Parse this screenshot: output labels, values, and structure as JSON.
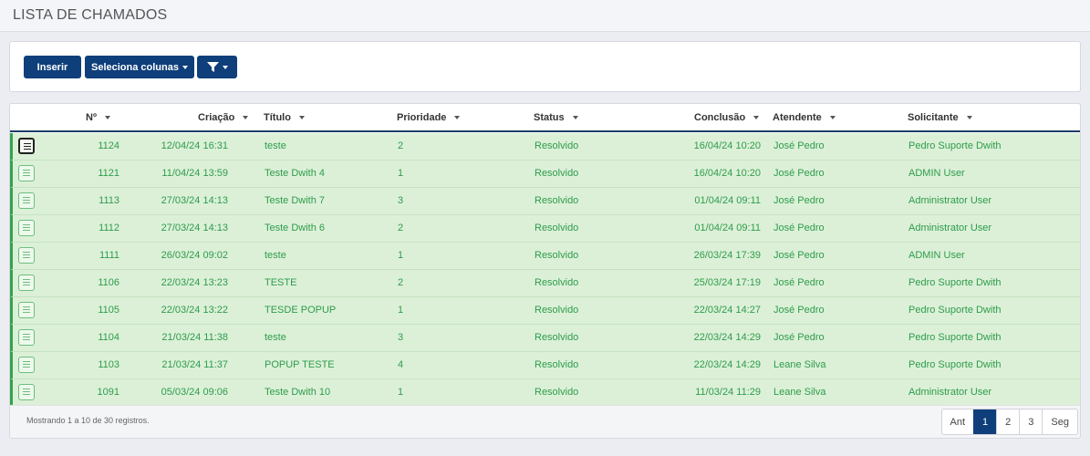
{
  "page": {
    "title": "LISTA DE CHAMADOS"
  },
  "toolbar": {
    "insert_label": "Inserir",
    "columns_label": "Seleciona colunas",
    "filter_icon": "funnel-icon"
  },
  "table": {
    "headers": {
      "num": "Nº",
      "created": "Criação",
      "title": "Título",
      "priority": "Prioridade",
      "status": "Status",
      "completed": "Conclusão",
      "agent": "Atendente",
      "requester": "Solicitante"
    },
    "rows": [
      {
        "num": "1124",
        "created": "12/04/24 16:31",
        "title": "teste",
        "priority": "2",
        "status": "Resolvido",
        "completed": "16/04/24 10:20",
        "agent": "José Pedro",
        "requester": "Pedro Suporte Dwith"
      },
      {
        "num": "1121",
        "created": "11/04/24 13:59",
        "title": "Teste Dwith 4",
        "priority": "1",
        "status": "Resolvido",
        "completed": "16/04/24 10:20",
        "agent": "José Pedro",
        "requester": "ADMIN User"
      },
      {
        "num": "1113",
        "created": "27/03/24 14:13",
        "title": "Teste Dwith 7",
        "priority": "3",
        "status": "Resolvido",
        "completed": "01/04/24 09:11",
        "agent": "José Pedro",
        "requester": "Administrator User"
      },
      {
        "num": "1112",
        "created": "27/03/24 14:13",
        "title": "Teste Dwith 6",
        "priority": "2",
        "status": "Resolvido",
        "completed": "01/04/24 09:11",
        "agent": "José Pedro",
        "requester": "Administrator User"
      },
      {
        "num": "1111",
        "created": "26/03/24 09:02",
        "title": "teste",
        "priority": "1",
        "status": "Resolvido",
        "completed": "26/03/24 17:39",
        "agent": "José Pedro",
        "requester": "ADMIN User"
      },
      {
        "num": "1106",
        "created": "22/03/24 13:23",
        "title": "TESTE",
        "priority": "2",
        "status": "Resolvido",
        "completed": "25/03/24 17:19",
        "agent": "José Pedro",
        "requester": "Pedro Suporte Dwith"
      },
      {
        "num": "1105",
        "created": "22/03/24 13:22",
        "title": "TESDE POPUP",
        "priority": "1",
        "status": "Resolvido",
        "completed": "22/03/24 14:27",
        "agent": "José Pedro",
        "requester": "Pedro Suporte Dwith"
      },
      {
        "num": "1104",
        "created": "21/03/24 11:38",
        "title": "teste",
        "priority": "3",
        "status": "Resolvido",
        "completed": "22/03/24 14:29",
        "agent": "José Pedro",
        "requester": "Pedro Suporte Dwith"
      },
      {
        "num": "1103",
        "created": "21/03/24 11:37",
        "title": "POPUP TESTE",
        "priority": "4",
        "status": "Resolvido",
        "completed": "22/03/24 14:29",
        "agent": "Leane Silva",
        "requester": "Pedro Suporte Dwith"
      },
      {
        "num": "1091",
        "created": "05/03/24 09:06",
        "title": "Teste Dwith 10",
        "priority": "1",
        "status": "Resolvido",
        "completed": "11/03/24 11:29",
        "agent": "Leane Silva",
        "requester": "Administrator User"
      }
    ],
    "row_color": "#dcf0d8",
    "text_color": "#2e9c4b"
  },
  "footer": {
    "info": "Mostrando 1 a 10 de 30 registros.",
    "prev": "Ant",
    "pages": [
      "1",
      "2",
      "3"
    ],
    "next": "Seg",
    "active_page": "1"
  },
  "colors": {
    "primary": "#0f3f7a",
    "success": "#2e9c4b"
  }
}
